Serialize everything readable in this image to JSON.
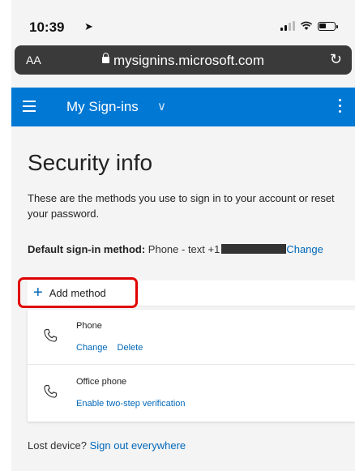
{
  "status_bar": {
    "time": "10:39",
    "location_arrow": "➤"
  },
  "browser": {
    "text_size_label": "AA",
    "url": "mysignins.microsoft.com",
    "reload_glyph": "↻"
  },
  "header": {
    "title": "My Sign-ins",
    "chevron": "∨",
    "accent_color": "#0078d4"
  },
  "page": {
    "title": "Security info",
    "description": "These are the methods you use to sign in to your account or reset your password.",
    "default_method_label": "Default sign-in method:",
    "default_method_value": "Phone - text +1",
    "default_method_change": "Change"
  },
  "add_method": {
    "plus": "+",
    "label": "Add method",
    "highlight_color": "#e00000"
  },
  "methods": [
    {
      "name": "Phone",
      "icon": "phone-icon",
      "links": [
        "Change",
        "Delete"
      ]
    },
    {
      "name": "Office phone",
      "icon": "phone-icon",
      "links": [
        "Enable two-step verification"
      ]
    }
  ],
  "footer": {
    "lost_device_text": "Lost device?",
    "sign_out_link": "Sign out everywhere"
  }
}
